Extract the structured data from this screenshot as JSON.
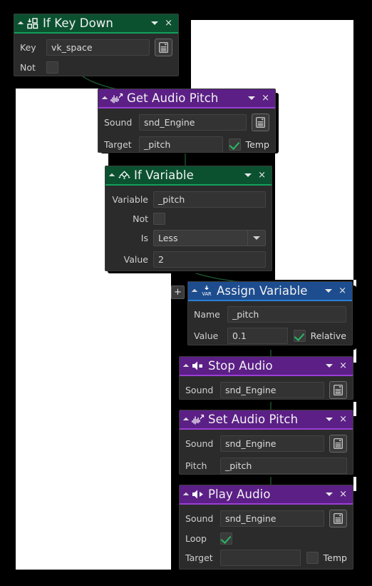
{
  "editor": {
    "canvas_background": "#ffffff",
    "frame_color": "#000000",
    "link_color": "#1e5c32",
    "add_button_label": "+"
  },
  "colors": {
    "condition_green": "#0b5130",
    "condition_green_accent": "#11a05c",
    "audio_purple": "#5b1f86",
    "audio_purple_accent": "#9b3fd4",
    "variable_blue": "#1d4d8f",
    "variable_blue_accent": "#2a7fd6",
    "checkbox_check": "#27b865",
    "field_background": "#333333",
    "node_background": "#2b2b2b"
  },
  "nodes": [
    {
      "id": "if-key-down",
      "title": "If Key Down",
      "icon": "keyboard-key-down-icon",
      "category": "condition",
      "collapse_label": "◢",
      "menu_label": "▾",
      "close_label": "×",
      "fields": [
        {
          "label": "Key",
          "value": "vk_space",
          "type": "text",
          "has_picker": true
        },
        {
          "label": "Not",
          "value": false,
          "type": "checkbox"
        }
      ]
    },
    {
      "id": "get-audio-pitch",
      "title": "Get Audio Pitch",
      "icon": "audio-waveform-up-icon",
      "category": "audio",
      "collapse_label": "◢",
      "menu_label": "▾",
      "close_label": "×",
      "fields": [
        {
          "label": "Sound",
          "value": "snd_Engine",
          "type": "text",
          "has_picker": true
        },
        {
          "label": "Target",
          "value": "_pitch",
          "type": "text",
          "suffix_checkbox": {
            "label": "Temp",
            "checked": true
          }
        }
      ]
    },
    {
      "id": "if-variable",
      "title": "If Variable",
      "icon": "branch-compare-icon",
      "category": "condition",
      "collapse_label": "◢",
      "menu_label": "▾",
      "close_label": "×",
      "fields": [
        {
          "label": "Variable",
          "value": "_pitch",
          "type": "text"
        },
        {
          "label": "Not",
          "value": false,
          "type": "checkbox"
        },
        {
          "label": "Is",
          "value": "Less",
          "type": "dropdown",
          "options": [
            "Less"
          ]
        },
        {
          "label": "Value",
          "value": "2",
          "type": "text"
        }
      ]
    },
    {
      "id": "assign-variable",
      "title": "Assign Variable",
      "icon": "assign-var-icon",
      "category": "variable",
      "collapse_label": "◢",
      "menu_label": "▾",
      "close_label": "×",
      "fields": [
        {
          "label": "Name",
          "value": "_pitch",
          "type": "text"
        },
        {
          "label": "Value",
          "value": "0.1",
          "type": "text",
          "suffix_checkbox": {
            "label": "Relative",
            "checked": true
          }
        }
      ]
    },
    {
      "id": "stop-audio",
      "title": "Stop Audio",
      "icon": "speaker-stop-icon",
      "category": "audio",
      "collapse_label": "◢",
      "menu_label": "▾",
      "close_label": "×",
      "fields": [
        {
          "label": "Sound",
          "value": "snd_Engine",
          "type": "text",
          "has_picker": true
        }
      ]
    },
    {
      "id": "set-audio-pitch",
      "title": "Set Audio Pitch",
      "icon": "audio-waveform-up-icon",
      "category": "audio",
      "collapse_label": "◢",
      "menu_label": "▾",
      "close_label": "×",
      "fields": [
        {
          "label": "Sound",
          "value": "snd_Engine",
          "type": "text",
          "has_picker": true
        },
        {
          "label": "Pitch",
          "value": "_pitch",
          "type": "text"
        }
      ]
    },
    {
      "id": "play-audio",
      "title": "Play Audio",
      "icon": "speaker-play-icon",
      "category": "audio",
      "collapse_label": "◢",
      "menu_label": "▾",
      "close_label": "×",
      "fields": [
        {
          "label": "Sound",
          "value": "snd_Engine",
          "type": "text",
          "has_picker": true
        },
        {
          "label": "Loop",
          "value": true,
          "type": "checkbox"
        },
        {
          "label": "Target",
          "value": "",
          "type": "text",
          "suffix_checkbox": {
            "label": "Temp",
            "checked": false
          }
        }
      ]
    }
  ]
}
